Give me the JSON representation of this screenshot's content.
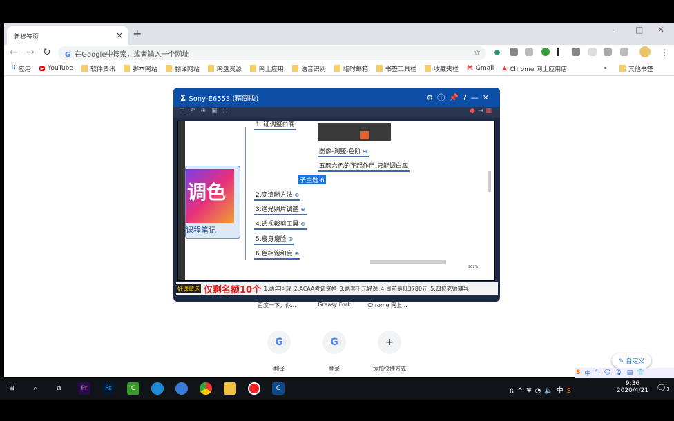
{
  "browser": {
    "tab_title": "新标签页",
    "omnibox_placeholder": "在Google中搜索，或者输入一个网址",
    "bookmarks": [
      "应用",
      "YouTube",
      "软件资讯",
      "脚本网站",
      "翻译网站",
      "网盘资源",
      "网上应用",
      "语音识别",
      "临时邮箱",
      "书签工具栏",
      "收藏夹栏",
      "Gmail",
      "Chrome 网上应用店"
    ],
    "other_bookmarks": "其他书签",
    "more": "»"
  },
  "popup": {
    "title": "Sony-E6553 (精简版)",
    "nodes": [
      "1. 证调整白底",
      "图像-调整-色阶",
      "五颜六色的不起作用 只能调白底",
      "子主题 6",
      "2.变清晰方法",
      "3.逆光照片调整",
      "4.透视裁剪工具",
      "5.瘦身瘦脸",
      "6.色相饱和度"
    ],
    "central_topic": "调色",
    "central_caption": "课程笔记",
    "zoom": "202%",
    "ad": {
      "tag": "好课赠送",
      "headline": "仅剩名额10个",
      "items": [
        "1.两年回放",
        "2.ACAA考证资格",
        "3.两套千元好课",
        "4.目前最低3780元",
        "5.四位老师辅导"
      ]
    }
  },
  "newtab": {
    "shortcuts_top": [
      "百度一下，你...",
      "Greasy Fork",
      "Chrome 网上..."
    ],
    "shortcuts": [
      {
        "icon": "G",
        "label": "翻译"
      },
      {
        "icon": "G",
        "label": "登录"
      },
      {
        "icon": "+",
        "label": "添加快捷方式"
      }
    ],
    "customize": "自定义"
  },
  "taskbar": {
    "time": "9:36",
    "date": "2020/4/21",
    "ime": "中",
    "notifications": "3"
  }
}
